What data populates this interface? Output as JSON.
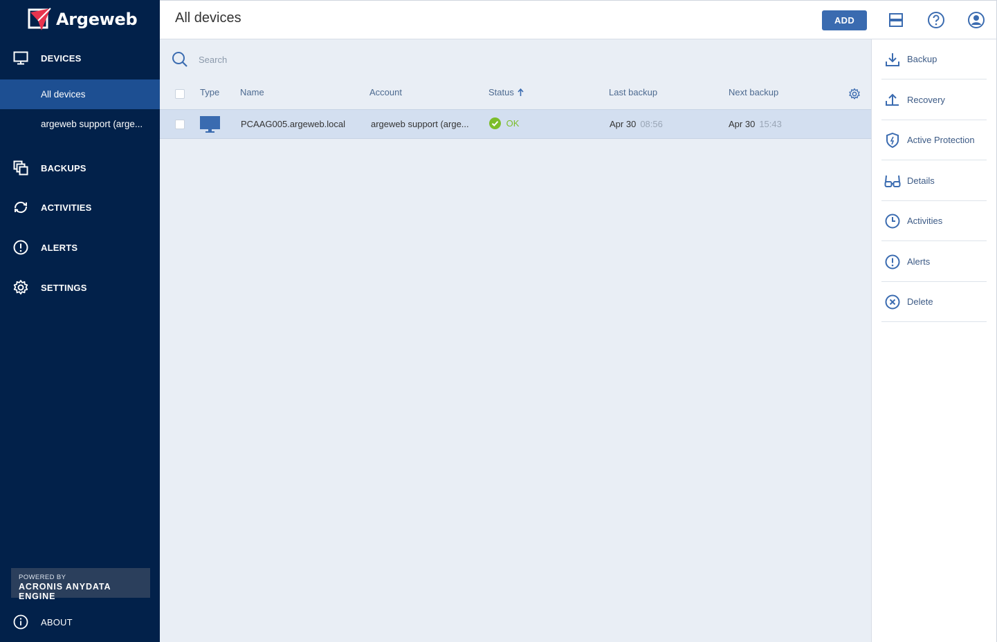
{
  "brand": {
    "name": "Argeweb"
  },
  "sidebar": {
    "sections": [
      {
        "key": "devices",
        "label": "DEVICES",
        "icon": "monitor-icon"
      },
      {
        "key": "backups",
        "label": "BACKUPS",
        "icon": "backups-icon"
      },
      {
        "key": "activities",
        "label": "ACTIVITIES",
        "icon": "activities-icon"
      },
      {
        "key": "alerts",
        "label": "ALERTS",
        "icon": "alert-icon"
      },
      {
        "key": "settings",
        "label": "SETTINGS",
        "icon": "gear-icon"
      }
    ],
    "device_items": [
      {
        "label": "All devices",
        "active": true
      },
      {
        "label": "argeweb support (arge...",
        "active": false
      }
    ],
    "powered_by": {
      "line1": "POWERED BY",
      "line2": "ACRONIS ANYDATA ENGINE"
    },
    "about": {
      "label": "ABOUT",
      "icon": "info-icon"
    }
  },
  "header": {
    "title": "All devices",
    "add_label": "ADD",
    "icons": [
      "view-toggle-icon",
      "help-icon",
      "user-icon"
    ]
  },
  "search": {
    "placeholder": "Search",
    "value": ""
  },
  "table": {
    "columns": [
      "Type",
      "Name",
      "Account",
      "Status",
      "Last backup",
      "Next backup"
    ],
    "sort_column": "Status",
    "sort_direction": "ascending",
    "rows": [
      {
        "type_icon": "desktop-icon",
        "name": "PCAAG005.argeweb.local",
        "account": "argeweb support (arge...",
        "status": "OK",
        "last_backup_date": "Apr 30",
        "last_backup_time": "08:56",
        "next_backup_date": "Apr 30",
        "next_backup_time": "15:43"
      }
    ]
  },
  "actions": [
    {
      "label": "Backup",
      "icon": "backup-icon"
    },
    {
      "label": "Recovery",
      "icon": "recovery-icon"
    },
    {
      "label": "Active Protection",
      "icon": "shield-icon"
    },
    {
      "label": "Details",
      "icon": "glasses-icon"
    },
    {
      "label": "Activities",
      "icon": "clock-icon"
    },
    {
      "label": "Alerts",
      "icon": "alert-icon"
    },
    {
      "label": "Delete",
      "icon": "delete-icon"
    }
  ],
  "colors": {
    "sidebar_bg": "#02214a",
    "sidebar_active": "#1d4f92",
    "accent": "#3a6bb0",
    "status_ok": "#7cbd2a",
    "row_selected": "#d3dff0"
  }
}
